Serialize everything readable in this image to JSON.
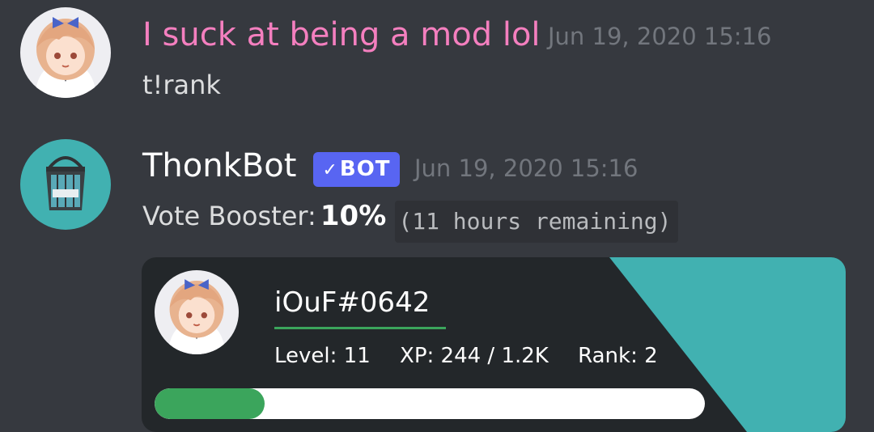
{
  "colors": {
    "background": "#36393f",
    "mod_name": "#f47fbf",
    "bot_name": "#ffffff",
    "bot_tag": "#5865f2",
    "teal_accent": "#41b1b1",
    "progress_green": "#3ba55c"
  },
  "messages": [
    {
      "author": "I suck at being a mod lol",
      "timestamp": "Jun 19, 2020 15:16",
      "content": "t!rank",
      "avatar_icon": "anime-girl-avatar-icon"
    },
    {
      "author": "ThonkBot",
      "bot_tag": "BOT",
      "bot_check_icon": "checkmark-icon",
      "timestamp": "Jun 19, 2020 15:16",
      "avatar_icon": "paint-bucket-avatar-icon",
      "vote": {
        "label": "Vote Booster:",
        "percent": "10%",
        "remaining": "(11 hours remaining)"
      }
    }
  ],
  "rank_card": {
    "username": "iOuF#0642",
    "level": "Level: 11",
    "xp": "XP: 244 / 1.2K",
    "rank": "Rank: 2",
    "progress_fraction": 0.2,
    "avatar_icon": "anime-girl-avatar-icon"
  }
}
